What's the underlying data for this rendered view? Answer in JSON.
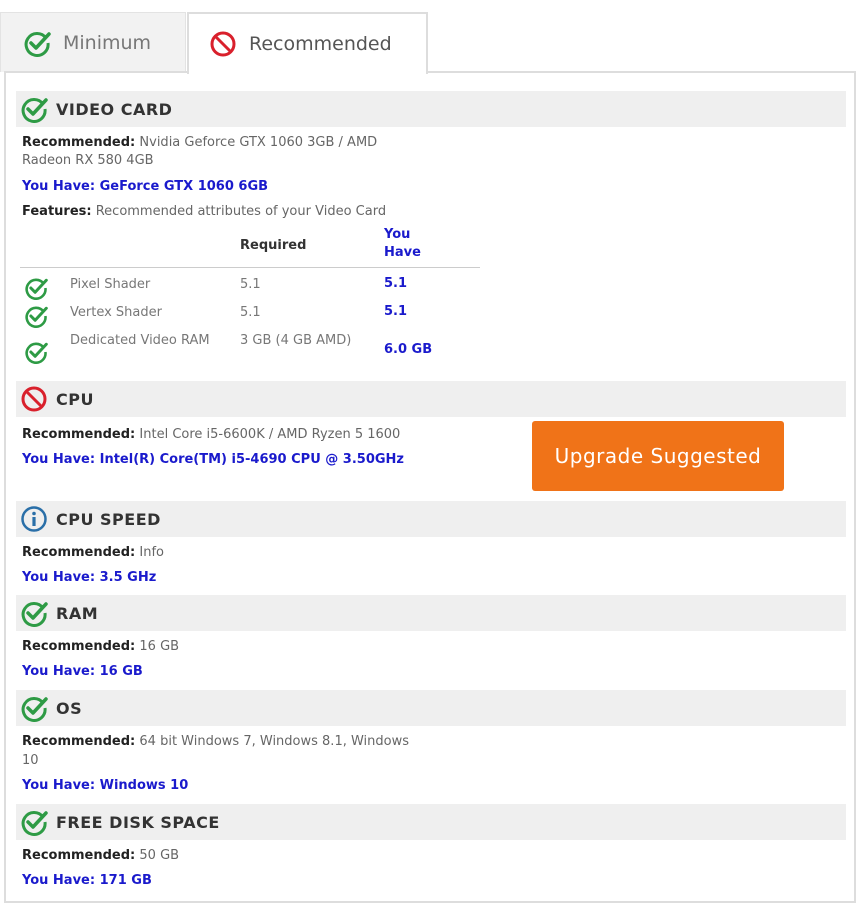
{
  "tabs": [
    {
      "label": "Minimum",
      "icon": "check-circle-icon",
      "active": false
    },
    {
      "label": "Recommended",
      "icon": "no-entry-icon",
      "active": true
    }
  ],
  "colors": {
    "check": "#2e9b45",
    "fail": "#d9202c",
    "info": "#2a6fa8",
    "link": "#1a1acc",
    "upgrade": "#f07318"
  },
  "sections": {
    "video_card": {
      "title": "VIDEO CARD",
      "status": "pass",
      "recommended_label": "Recommended:",
      "recommended_value_1": "Nvidia Geforce GTX 1060 3GB / AMD",
      "recommended_value_2": "Radeon RX 580 4GB",
      "have_label": "You Have:",
      "have_value": "GeForce GTX 1060 6GB",
      "features_label": "Features:",
      "features_value": "Recommended attributes of your Video Card",
      "table": {
        "col_required": "Required",
        "col_have": "You Have",
        "rows": [
          {
            "name": "Pixel Shader",
            "required": "5.1",
            "have": "5.1"
          },
          {
            "name": "Vertex Shader",
            "required": "5.1",
            "have": "5.1"
          },
          {
            "name": "Dedicated Video RAM",
            "required": "3 GB (4 GB AMD)",
            "have": "6.0 GB"
          }
        ]
      }
    },
    "cpu": {
      "title": "CPU",
      "status": "fail",
      "recommended_label": "Recommended:",
      "recommended_value": "Intel Core i5-6600K / AMD Ryzen 5 1600",
      "have_label": "You Have:",
      "have_value": "Intel(R) Core(TM) i5-4690 CPU @ 3.50GHz",
      "button": "Upgrade Suggested"
    },
    "cpu_speed": {
      "title": "CPU SPEED",
      "status": "info",
      "recommended_label": "Recommended:",
      "recommended_value": "Info",
      "have_label": "You Have:",
      "have_value": "3.5 GHz"
    },
    "ram": {
      "title": "RAM",
      "status": "pass",
      "recommended_label": "Recommended:",
      "recommended_value": "16 GB",
      "have_label": "You Have:",
      "have_value": "16 GB"
    },
    "os": {
      "title": "OS",
      "status": "pass",
      "recommended_label": "Recommended:",
      "recommended_value_1": "64 bit Windows 7, Windows 8.1, Windows",
      "recommended_value_2": "10",
      "have_label": "You Have:",
      "have_value": "Windows 10"
    },
    "disk": {
      "title": "FREE DISK SPACE",
      "status": "pass",
      "recommended_label": "Recommended:",
      "recommended_value": "50 GB",
      "have_label": "You Have:",
      "have_value": "171 GB"
    }
  }
}
